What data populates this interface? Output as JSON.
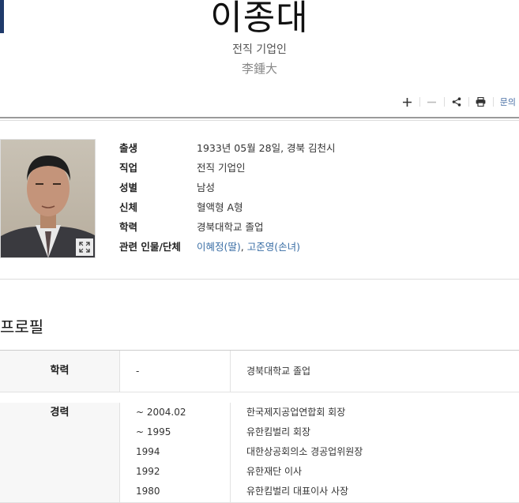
{
  "header": {
    "name": "이종대",
    "occupation": "전직 기업인",
    "hanja": "李鍾大"
  },
  "toolbar": {
    "zoom_in_icon": "plus-icon",
    "zoom_out_icon": "minus-icon",
    "share_icon": "share-icon",
    "print_icon": "print-icon",
    "inquiry_label": "문의"
  },
  "person": {
    "photo_icon": "expand-icon",
    "rows": [
      {
        "label": "출생",
        "value": "1933년 05월 28일, 경북 김천시"
      },
      {
        "label": "직업",
        "value": "전직 기업인"
      },
      {
        "label": "성별",
        "value": "남성"
      },
      {
        "label": "신체",
        "value": "혈액형 A형"
      },
      {
        "label": "학력",
        "value": "경북대학교 졸업"
      }
    ],
    "related_label": "관련 인물/단체",
    "related": [
      "이혜정(딸)",
      "고준영(손녀)"
    ]
  },
  "profile": {
    "title": "프로필",
    "education": {
      "label": "학력",
      "year": "-",
      "value": "경북대학교 졸업"
    },
    "career": {
      "label": "경력",
      "entries": [
        {
          "year": "~ 2004.02",
          "value": "한국제지공업연합회 회장"
        },
        {
          "year": "~ 1995",
          "value": "유한킴벌리 회장"
        },
        {
          "year": "1994",
          "value": "대한상공회의소 경공업위원장"
        },
        {
          "year": "1992",
          "value": "유한재단 이사"
        },
        {
          "year": "1980",
          "value": "유한킴벌리 대표이사 사장"
        }
      ]
    }
  }
}
